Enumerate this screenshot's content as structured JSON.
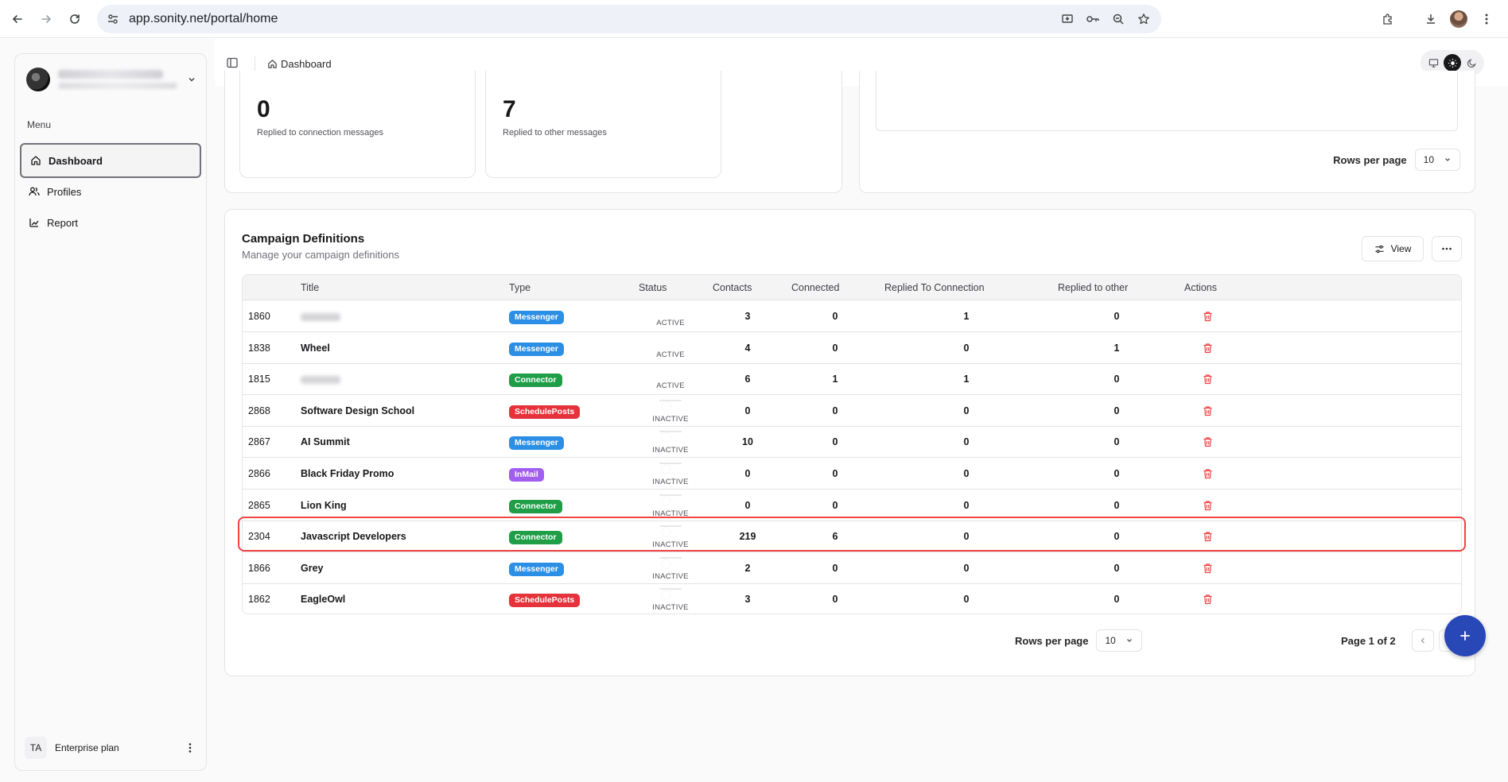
{
  "browser": {
    "url": "app.sonity.net/portal/home"
  },
  "sidebar": {
    "menu_label": "Menu",
    "items": [
      {
        "label": "Dashboard",
        "icon": "home-icon",
        "active": true
      },
      {
        "label": "Profiles",
        "icon": "users-icon",
        "active": false
      },
      {
        "label": "Report",
        "icon": "chart-icon",
        "active": false
      }
    ],
    "plan": {
      "initials": "TA",
      "name": "Enterprise plan"
    }
  },
  "header": {
    "breadcrumb": "Dashboard"
  },
  "stats": [
    {
      "value": "0",
      "label": "Replied to connection messages"
    },
    {
      "value": "7",
      "label": "Replied to other messages"
    }
  ],
  "top_pager": {
    "rows_label": "Rows per page",
    "rows_value": "10"
  },
  "campaigns": {
    "title": "Campaign Definitions",
    "subtitle": "Manage your campaign definitions",
    "view_label": "View",
    "columns": [
      "Title",
      "Type",
      "Status",
      "Contacts",
      "Connected",
      "Replied To Connection",
      "Replied to other",
      "Actions"
    ],
    "rows": [
      {
        "id": "1860",
        "title": "",
        "title_blurred": true,
        "type": "Messenger",
        "status": "ACTIVE",
        "contacts": "3",
        "connected": "0",
        "replied_conn": "1",
        "replied_other": "0"
      },
      {
        "id": "1838",
        "title": "Wheel",
        "title_blurred": false,
        "type": "Messenger",
        "status": "ACTIVE",
        "contacts": "4",
        "connected": "0",
        "replied_conn": "0",
        "replied_other": "1"
      },
      {
        "id": "1815",
        "title": "",
        "title_blurred": true,
        "type": "Connector",
        "status": "ACTIVE",
        "contacts": "6",
        "connected": "1",
        "replied_conn": "1",
        "replied_other": "0"
      },
      {
        "id": "2868",
        "title": "Software Design School",
        "title_blurred": false,
        "type": "SchedulePosts",
        "status": "INACTIVE",
        "contacts": "0",
        "connected": "0",
        "replied_conn": "0",
        "replied_other": "0"
      },
      {
        "id": "2867",
        "title": "AI Summit",
        "title_blurred": false,
        "type": "Messenger",
        "status": "INACTIVE",
        "contacts": "10",
        "connected": "0",
        "replied_conn": "0",
        "replied_other": "0"
      },
      {
        "id": "2866",
        "title": "Black Friday Promo",
        "title_blurred": false,
        "type": "InMail",
        "status": "INACTIVE",
        "contacts": "0",
        "connected": "0",
        "replied_conn": "0",
        "replied_other": "0"
      },
      {
        "id": "2865",
        "title": "Lion King",
        "title_blurred": false,
        "type": "Connector",
        "status": "INACTIVE",
        "contacts": "0",
        "connected": "0",
        "replied_conn": "0",
        "replied_other": "0"
      },
      {
        "id": "2304",
        "title": "Javascript Developers",
        "title_blurred": false,
        "type": "Connector",
        "status": "INACTIVE",
        "contacts": "219",
        "connected": "6",
        "replied_conn": "0",
        "replied_other": "0",
        "highlighted": true
      },
      {
        "id": "1866",
        "title": "Grey",
        "title_blurred": false,
        "type": "Messenger",
        "status": "INACTIVE",
        "contacts": "2",
        "connected": "0",
        "replied_conn": "0",
        "replied_other": "0"
      },
      {
        "id": "1862",
        "title": "EagleOwl",
        "title_blurred": false,
        "type": "SchedulePosts",
        "status": "INACTIVE",
        "contacts": "3",
        "connected": "0",
        "replied_conn": "0",
        "replied_other": "0"
      }
    ],
    "type_colors": {
      "Messenger": "#2b8fe6",
      "Connector": "#1f9d47",
      "SchedulePosts": "#e5323b",
      "InMail": "#a15ef0"
    }
  },
  "bottom_pager": {
    "rows_label": "Rows per page",
    "rows_value": "10",
    "page_info": "Page 1 of 2"
  },
  "colors": {
    "accent": "#2848b8",
    "highlight": "#ef4444",
    "delete": "#ef4444"
  }
}
